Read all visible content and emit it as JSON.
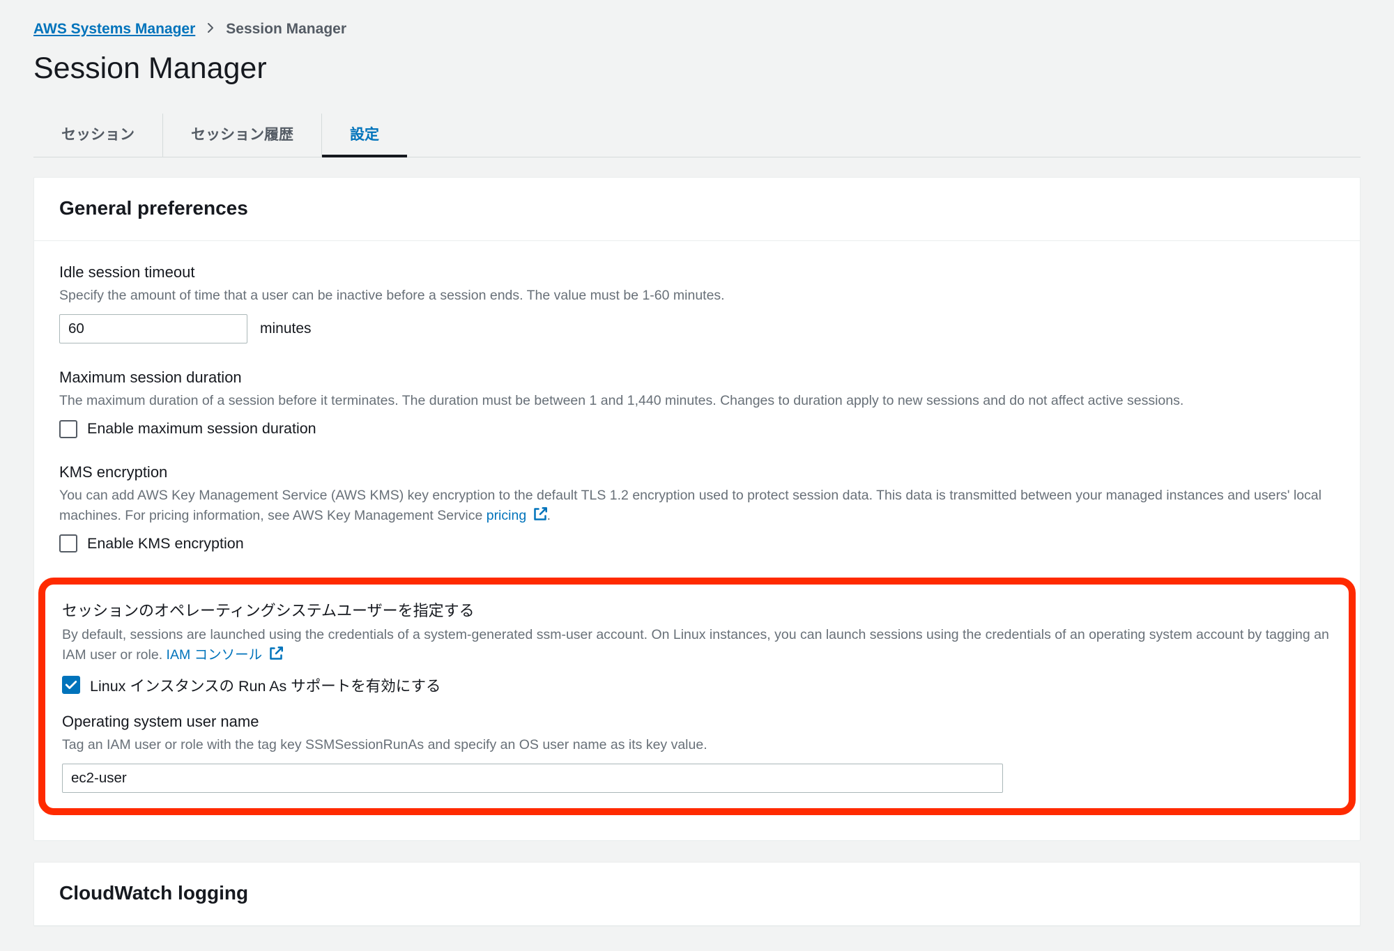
{
  "breadcrumb": {
    "root": "AWS Systems Manager",
    "current": "Session Manager"
  },
  "page_title": "Session Manager",
  "tabs": {
    "sessions": "セッション",
    "history": "セッション履歴",
    "settings": "設定"
  },
  "prefs": {
    "heading": "General preferences",
    "idle": {
      "title": "Idle session timeout",
      "desc": "Specify the amount of time that a user can be inactive before a session ends. The value must be 1-60 minutes.",
      "value": "60",
      "unit": "minutes"
    },
    "maxdur": {
      "title": "Maximum session duration",
      "desc": "The maximum duration of a session before it terminates. The duration must be between 1 and 1,440 minutes. Changes to duration apply to new sessions and do not affect active sessions.",
      "checkbox_label": "Enable maximum session duration"
    },
    "kms": {
      "title": "KMS encryption",
      "desc_prefix": "You can add AWS Key Management Service (AWS KMS) key encryption to the default TLS 1.2 encryption used to protect session data. This data is transmitted between your managed instances and users' local machines. For pricing information, see AWS Key Management Service ",
      "link_text": "pricing",
      "desc_suffix": ".",
      "checkbox_label": "Enable KMS encryption"
    },
    "runas": {
      "title": "セッションのオペレーティングシステムユーザーを指定する",
      "desc_prefix": "By default, sessions are launched using the credentials of a system-generated ssm-user account. On Linux instances, you can launch sessions using the credentials of an operating system account by tagging an IAM user or role. ",
      "link_text": "IAM コンソール",
      "checkbox_label": "Linux インスタンスの Run As サポートを有効にする"
    },
    "osname": {
      "title": "Operating system user name",
      "desc": "Tag an IAM user or role with the tag key SSMSessionRunAs and specify an OS user name as its key value.",
      "value": "ec2-user"
    }
  },
  "cloudwatch": {
    "heading": "CloudWatch logging"
  }
}
